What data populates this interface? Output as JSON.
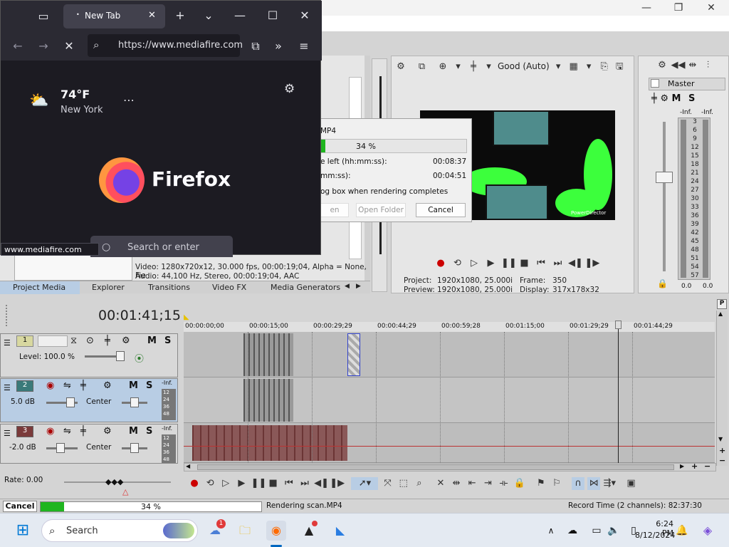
{
  "browser": {
    "tab_label": "New Tab",
    "url": "https://www.mediafire.com",
    "weather_temp": "74°F",
    "weather_city": "New York",
    "brand": "Firefox",
    "search_placeholder": "Search or enter",
    "status_url": "www.mediafire.com"
  },
  "render_dialog": {
    "file": "MP4",
    "progress_text": "34 %",
    "progress_percent": 34,
    "time_left_label": "e left (hh:mm:ss):",
    "time_left_value": "00:08:37",
    "elapsed_label": "mm:ss):",
    "elapsed_value": "00:04:51",
    "close_label": "og box when rendering completes",
    "open_label": "en",
    "open_folder_label": "Open Folder",
    "cancel_label": "Cancel"
  },
  "preview": {
    "quality": "Good (Auto)",
    "project_label": "Project:",
    "project_value": "1920x1080, 25.000i",
    "preview_label": "Preview:",
    "preview_value": "1920x1080, 25.000i",
    "frame_label": "Frame:",
    "frame_value": "350",
    "display_label": "Display:",
    "display_value": "317x178x32",
    "watermark": "PowerDirector"
  },
  "master": {
    "title": "Master",
    "m": "M",
    "s": "S",
    "inf_left": "-Inf.",
    "inf_right": "-Inf.",
    "ticks": [
      "3",
      "6",
      "9",
      "12",
      "15",
      "18",
      "21",
      "24",
      "27",
      "30",
      "33",
      "36",
      "39",
      "42",
      "45",
      "48",
      "51",
      "54",
      "57"
    ],
    "bottom_left": "0.0",
    "bottom_right": "0.0"
  },
  "project_media": {
    "video_info": "Video: 1280x720x12, 30.000 fps, 00:00:19;04, Alpha = None, Fie",
    "audio_info": "Audio: 44,100 Hz, Stereo, 00:00:19;04, AAC",
    "tabs": [
      "Project Media",
      "Explorer",
      "Transitions",
      "Video FX",
      "Media Generators"
    ]
  },
  "timeline": {
    "timecode": "00:01:41;15",
    "ruler": [
      "00:00:00;00",
      "00:00:15;00",
      "00:00:29;29",
      "00:00:44;29",
      "00:00:59;28",
      "00:01:15;00",
      "00:01:29;29",
      "00:01:44;29"
    ],
    "tracks": [
      {
        "num": "1",
        "level": "Level: 100.0 %",
        "m": "M",
        "s": "S"
      },
      {
        "num": "2",
        "vol": "5.0 dB",
        "pan": "Center",
        "m": "M",
        "s": "S",
        "inf": "-Inf.",
        "meter": [
          "12",
          "24",
          "36",
          "48"
        ]
      },
      {
        "num": "3",
        "vol": "-2.0 dB",
        "pan": "Center",
        "m": "M",
        "s": "S",
        "inf": "-Inf.",
        "meter": [
          "12",
          "24",
          "36",
          "48"
        ]
      }
    ],
    "rate": "Rate: 0.00"
  },
  "status": {
    "cancel": "Cancel",
    "progress_text": "34 %",
    "progress_percent": 34,
    "rendering": "Rendering scan.MP4",
    "record_time": "Record Time (2 channels): 82:37:30"
  },
  "taskbar": {
    "search": "Search",
    "time": "6:24 PM",
    "date": "8/12/2024",
    "badge": "1"
  },
  "colors": {
    "progress_green": "#1fb51f",
    "selection_blue": "#b8cde4",
    "firefox_bg": "#1c1b22",
    "chroma_green": "#3cff3c"
  }
}
